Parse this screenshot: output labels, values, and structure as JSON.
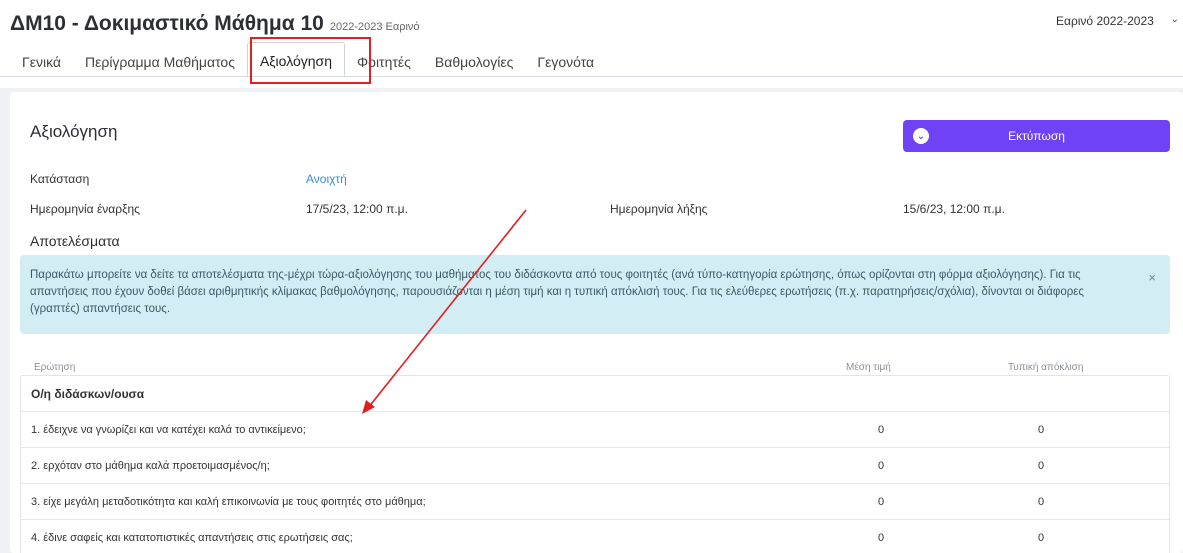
{
  "header": {
    "course_title": "ΔΜ10 - Δοκιμαστικό Μάθημα 10",
    "semester_label": "2022-2023 Εαρινό",
    "semester_select": "Εαρινό 2022-2023"
  },
  "tabs": [
    {
      "label": "Γενικά"
    },
    {
      "label": "Περίγραμμα Μαθήματος"
    },
    {
      "label": "Αξιολόγηση"
    },
    {
      "label": "Φοιτητές"
    },
    {
      "label": "Βαθμολογίες"
    },
    {
      "label": "Γεγονότα"
    }
  ],
  "evaluation": {
    "title": "Αξιολόγηση",
    "print_label": "Εκτύπωση",
    "status_label": "Κατάσταση",
    "status_value": "Ανοιχτή",
    "start_label": "Ημερομηνία έναρξης",
    "start_value": "17/5/23, 12:00 π.μ.",
    "end_label": "Ημερομηνία λήξης",
    "end_value": "15/6/23, 12:00 π.μ."
  },
  "results": {
    "title": "Αποτελέσματα",
    "alert_text": "Παρακάτω μπορείτε να δείτε τα αποτελέσματα της-μέχρι τώρα-αξιολόγησης του μαθήματος του διδάσκοντα από τους φοιτητές (ανά τύπο-κατηγορία ερώτησης, όπως ορίζονται στη φόρμα αξιολόγησης). Για τις απαντήσεις που έχουν δοθεί βάσει αριθμητικής κλίμακας βαθμολόγησης, παρουσιάζονται η μέση τιμή και η τυπική απόκλισή τους. Για τις ελεύθερες ερωτήσεις (π.χ. παρατηρήσεις/σχόλια), δίνονται οι διάφορες (γραπτές) απαντήσεις τους.",
    "close_symbol": "×"
  },
  "table": {
    "headers": {
      "question": "Ερώτηση",
      "mean": "Μέση τιμή",
      "std": "Τυπική απόκλιση"
    },
    "group": "Ο/η διδάσκων/ουσα",
    "rows": [
      {
        "question": "1. έδειχνε να γνωρίζει και να κατέχει καλά το αντικείμενο;",
        "mean": "0",
        "std": "0"
      },
      {
        "question": "2. ερχόταν στο μάθημα καλά προετοιμασμένος/η;",
        "mean": "0",
        "std": "0"
      },
      {
        "question": "3. είχε μεγάλη μεταδοτικότητα και καλή επικοινωνία με τους φοιτητές στο μάθημα;",
        "mean": "0",
        "std": "0"
      },
      {
        "question": "4. έδινε σαφείς και κατατοπιστικές απαντήσεις στις ερωτήσεις σας;",
        "mean": "0",
        "std": "0"
      }
    ]
  },
  "colors": {
    "accent": "#6f42f5",
    "link": "#3b8fd9",
    "alert_bg": "#d3edf4",
    "annotation": "#e02020"
  }
}
